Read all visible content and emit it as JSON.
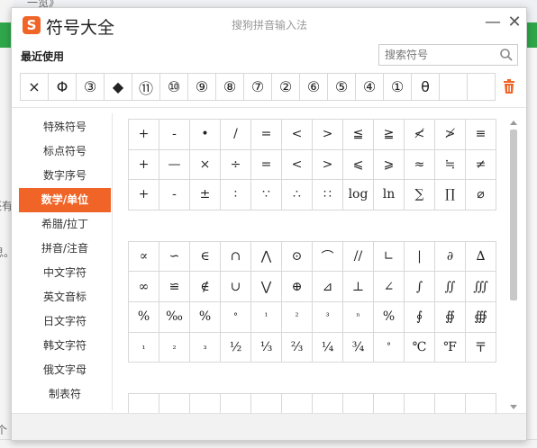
{
  "app": {
    "title": "符号大全",
    "ime_name": "搜狗拼音输入法",
    "logo_letter": "S",
    "min_label": "—",
    "close_label": "✕"
  },
  "recent": {
    "label": "最近使用",
    "symbols": [
      "×",
      "Φ",
      "③",
      "◆",
      "⑪",
      "⑩",
      "⑨",
      "⑧",
      "⑦",
      "②",
      "⑥",
      "⑤",
      "④",
      "①",
      "θ",
      "",
      ""
    ]
  },
  "search": {
    "placeholder": "搜索符号"
  },
  "sidebar": {
    "items": [
      {
        "label": "特殊符号",
        "active": false
      },
      {
        "label": "标点符号",
        "active": false
      },
      {
        "label": "数字序号",
        "active": false
      },
      {
        "label": "数学/单位",
        "active": true
      },
      {
        "label": "希腊/拉丁",
        "active": false
      },
      {
        "label": "拼音/注音",
        "active": false
      },
      {
        "label": "中文字符",
        "active": false
      },
      {
        "label": "英文音标",
        "active": false
      },
      {
        "label": "日文字符",
        "active": false
      },
      {
        "label": "韩文字符",
        "active": false
      },
      {
        "label": "俄文字母",
        "active": false
      },
      {
        "label": "制表符",
        "active": false
      }
    ]
  },
  "symbols": {
    "block1": [
      [
        "+",
        "-",
        "•",
        "/",
        "=",
        "<",
        ">",
        "≦",
        "≧",
        "≮",
        "≯",
        "≡"
      ],
      [
        "+",
        "—",
        "×",
        "÷",
        "=",
        "<",
        ">",
        "⩽",
        "⩾",
        "≈",
        "≒",
        "≠"
      ],
      [
        "+",
        "-",
        "±",
        "∶",
        "∵",
        "∴",
        "∷",
        "log",
        "ln",
        "∑",
        "∏",
        "⌀"
      ]
    ],
    "block2": [
      [
        "∝",
        "∽",
        "∈",
        "∩",
        "⋀",
        "⊙",
        "⌒",
        "//",
        "∟",
        "|",
        "∂",
        "∆"
      ],
      [
        "∞",
        "≌",
        "∉",
        "∪",
        "⋁",
        "⊕",
        "⊿",
        "⊥",
        "∠",
        "∫",
        "∬",
        "∭"
      ],
      [
        "%",
        "‰",
        "%",
        "°",
        "¹",
        "²",
        "³",
        "ⁿ",
        "%",
        "∮",
        "∯",
        "∰"
      ],
      [
        "₁",
        "₂",
        "₃",
        "½",
        "⅓",
        "⅔",
        "¼",
        "¾",
        "°",
        "℃",
        "℉",
        "〒"
      ]
    ]
  },
  "colors": {
    "accent": "#f06527",
    "bg_green": "#2fa64a"
  },
  "background": {
    "left_text_1": "还有",
    "left_text_2": "思。",
    "left_text_3": "个",
    "top_text": "一览》"
  }
}
